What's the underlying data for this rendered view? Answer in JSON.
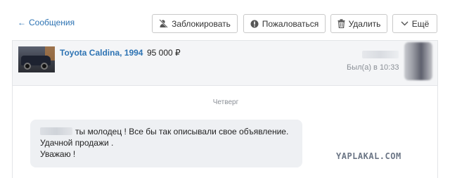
{
  "header": {
    "back_label": "Сообщения",
    "buttons": {
      "block": "Заблокировать",
      "report": "Пожаловаться",
      "delete": "Удалить",
      "more": "Ещё"
    }
  },
  "listing": {
    "title": "Toyota Caldina, 1994",
    "price": "95 000 ₽",
    "last_seen": "Был(а) в 10:33"
  },
  "chat": {
    "day_separator": "Четверг",
    "message": {
      "line1": "ты молодец ! Все бы так описывали свое объявление.",
      "line2": "Удачной продажи .",
      "line3": "Уважаю !"
    }
  },
  "watermark": "YAPLAKAL.COM",
  "colors": {
    "link": "#2d73b3",
    "bubble": "#eef0f3",
    "listing_bg": "#f4f5f7",
    "muted": "#8a8f96"
  }
}
